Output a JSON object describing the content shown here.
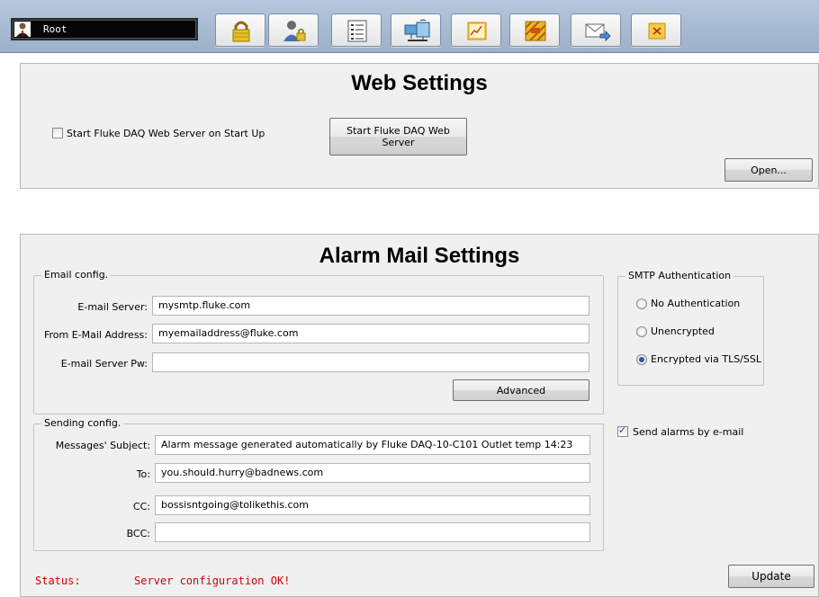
{
  "toolbar": {
    "user_name": "Root",
    "buttons": [
      {
        "icon": "lock-icon"
      },
      {
        "icon": "user-security-icon"
      },
      {
        "icon": "list-icon"
      },
      {
        "icon": "network-icon"
      },
      {
        "icon": "chart-icon"
      },
      {
        "icon": "warning-sign-icon"
      },
      {
        "icon": "mail-send-icon"
      },
      {
        "icon": "close-icon"
      }
    ]
  },
  "web": {
    "title": "Web Settings",
    "startup_checkbox_label": "Start Fluke DAQ Web Server on Start Up",
    "startup_checked": false,
    "start_button": "Start Fluke DAQ Web Server",
    "open_button": "Open..."
  },
  "alarm": {
    "title": "Alarm Mail Settings",
    "email_config": {
      "legend": "Email config.",
      "server_label": "E-mail Server:",
      "server_value": "mysmtp.fluke.com",
      "from_label": "From E-Mail Address:",
      "from_value": "myemailaddress@fluke.com",
      "pw_label": "E-mail Server Pw:",
      "pw_value": "",
      "advanced_button": "Advanced"
    },
    "smtp": {
      "legend": "SMTP Authentication",
      "options": [
        "No Authentication",
        "Unencrypted",
        "Encrypted via TLS/SSL"
      ],
      "selected": "Encrypted via TLS/SSL"
    },
    "sending_config": {
      "legend": "Sending config.",
      "subject_label": "Messages' Subject:",
      "subject_value": "Alarm message generated automatically by Fluke DAQ-10-C101 Outlet temp 14:23",
      "to_label": "To:",
      "to_value": "you.should.hurry@badnews.com",
      "cc_label": "CC:",
      "cc_value": "bossisntgoing@tolikethis.com",
      "bcc_label": "BCC:",
      "bcc_value": ""
    },
    "send_alarms_label": "Send alarms by e-mail",
    "send_alarms_checked": true,
    "status_label": "Status:",
    "status_text": "Server configuration OK!",
    "update_button": "Update"
  }
}
